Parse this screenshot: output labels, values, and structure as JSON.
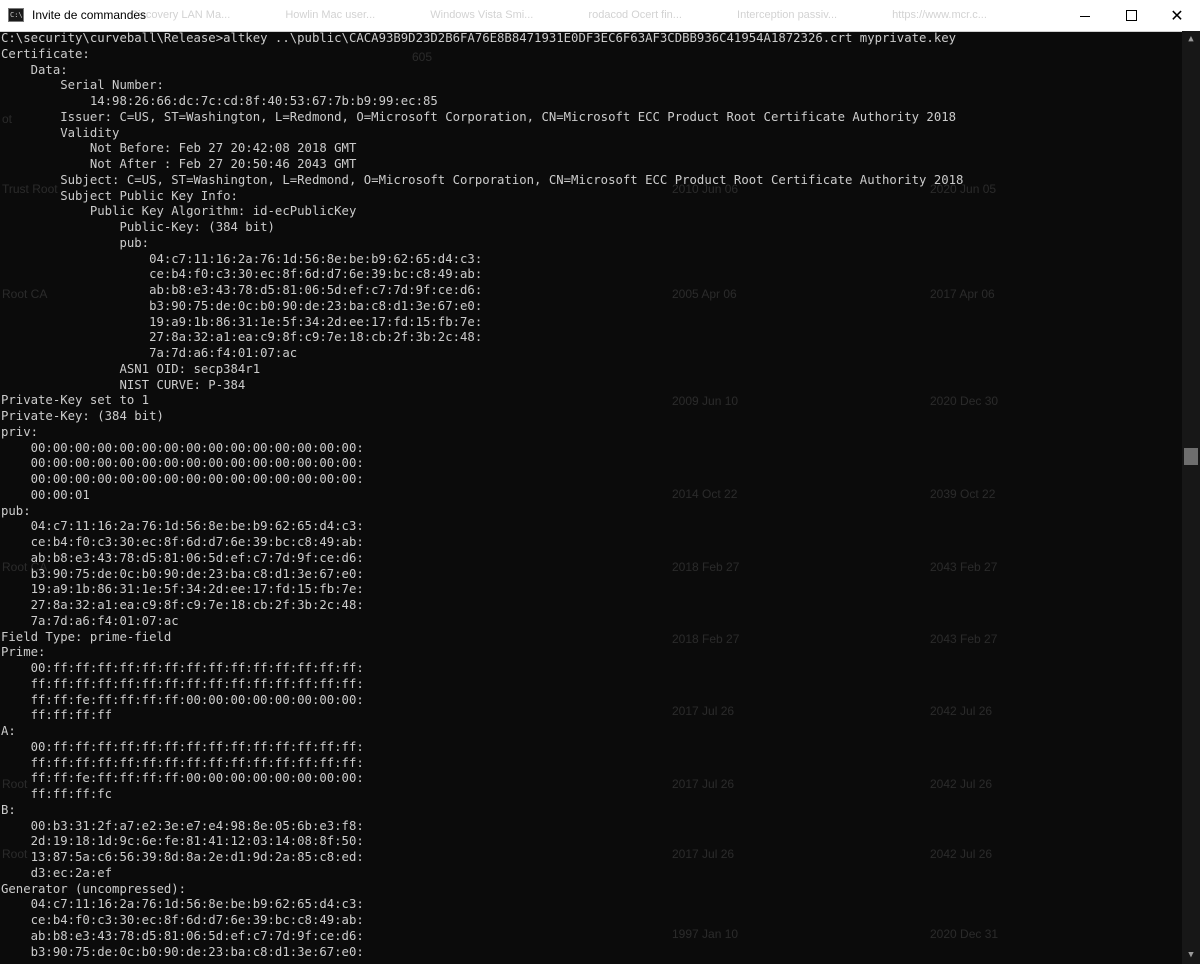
{
  "window": {
    "title": "Invite de commandes",
    "icon": "cmd-icon",
    "controls": {
      "minimize": "minimize-icon",
      "maximize": "maximize-icon",
      "close": "close-icon"
    }
  },
  "background_tabs": [
    "Ciscovery LAN Ma...",
    "Howlin Mac user...",
    "Windows Vista Smi...",
    "rodacod Ocert fin...",
    "Interception passiv...",
    "https://www.mcr.c..."
  ],
  "background_table_rows": [
    [
      "",
      "",
      "605",
      "",
      ""
    ],
    [
      "ot",
      "",
      "",
      "",
      ""
    ],
    [
      "Trust Root",
      "",
      "",
      "2010 Jun 06",
      "2020 Jun 05"
    ],
    [
      "Root CA",
      "",
      "",
      "2005 Apr 06",
      "2017 Apr 06"
    ],
    [
      "",
      "",
      "",
      "2009 Jun 10",
      "2020 Dec 30"
    ],
    [
      "",
      "",
      "",
      "2014 Oct 22",
      "2039 Oct 22"
    ],
    [
      "Root CA",
      "",
      "",
      "2018 Feb 27",
      "2043 Feb 27"
    ],
    [
      "",
      "",
      "",
      "2018 Feb 27",
      "2043 Feb 27"
    ],
    [
      "",
      "",
      "",
      "2017 Jul 26",
      "2042 Jul 26"
    ],
    [
      "Root",
      "",
      "",
      "2017 Jul 26",
      "2042 Jul 26"
    ],
    [
      "Root",
      "",
      "",
      "2017 Jul 26",
      "2042 Jul 26"
    ],
    [
      "",
      "",
      "",
      "1997 Jan 10",
      "2020 Dec 31"
    ]
  ],
  "console": {
    "lines": [
      "C:\\security\\curveball\\Release>altkey ..\\public\\CACA93B9D23D2B6FA76E8B8471931E0DF3EC6F63AF3CDBB936C41954A1872326.crt myprivate.key",
      "Certificate:",
      "    Data:",
      "        Serial Number:",
      "            14:98:26:66:dc:7c:cd:8f:40:53:67:7b:b9:99:ec:85",
      "        Issuer: C=US, ST=Washington, L=Redmond, O=Microsoft Corporation, CN=Microsoft ECC Product Root Certificate Authority 2018",
      "        Validity",
      "            Not Before: Feb 27 20:42:08 2018 GMT",
      "            Not After : Feb 27 20:50:46 2043 GMT",
      "        Subject: C=US, ST=Washington, L=Redmond, O=Microsoft Corporation, CN=Microsoft ECC Product Root Certificate Authority 2018",
      "        Subject Public Key Info:",
      "            Public Key Algorithm: id-ecPublicKey",
      "                Public-Key: (384 bit)",
      "                pub:",
      "                    04:c7:11:16:2a:76:1d:56:8e:be:b9:62:65:d4:c3:",
      "                    ce:b4:f0:c3:30:ec:8f:6d:d7:6e:39:bc:c8:49:ab:",
      "                    ab:b8:e3:43:78:d5:81:06:5d:ef:c7:7d:9f:ce:d6:",
      "                    b3:90:75:de:0c:b0:90:de:23:ba:c8:d1:3e:67:e0:",
      "                    19:a9:1b:86:31:1e:5f:34:2d:ee:17:fd:15:fb:7e:",
      "                    27:8a:32:a1:ea:c9:8f:c9:7e:18:cb:2f:3b:2c:48:",
      "                    7a:7d:a6:f4:01:07:ac",
      "                ASN1 OID: secp384r1",
      "                NIST CURVE: P-384",
      "Private-Key set to 1",
      "Private-Key: (384 bit)",
      "priv:",
      "    00:00:00:00:00:00:00:00:00:00:00:00:00:00:00:",
      "    00:00:00:00:00:00:00:00:00:00:00:00:00:00:00:",
      "    00:00:00:00:00:00:00:00:00:00:00:00:00:00:00:",
      "    00:00:01",
      "pub:",
      "    04:c7:11:16:2a:76:1d:56:8e:be:b9:62:65:d4:c3:",
      "    ce:b4:f0:c3:30:ec:8f:6d:d7:6e:39:bc:c8:49:ab:",
      "    ab:b8:e3:43:78:d5:81:06:5d:ef:c7:7d:9f:ce:d6:",
      "    b3:90:75:de:0c:b0:90:de:23:ba:c8:d1:3e:67:e0:",
      "    19:a9:1b:86:31:1e:5f:34:2d:ee:17:fd:15:fb:7e:",
      "    27:8a:32:a1:ea:c9:8f:c9:7e:18:cb:2f:3b:2c:48:",
      "    7a:7d:a6:f4:01:07:ac",
      "Field Type: prime-field",
      "Prime:",
      "    00:ff:ff:ff:ff:ff:ff:ff:ff:ff:ff:ff:ff:ff:ff:",
      "    ff:ff:ff:ff:ff:ff:ff:ff:ff:ff:ff:ff:ff:ff:ff:",
      "    ff:ff:fe:ff:ff:ff:ff:00:00:00:00:00:00:00:00:",
      "    ff:ff:ff:ff",
      "A:",
      "    00:ff:ff:ff:ff:ff:ff:ff:ff:ff:ff:ff:ff:ff:ff:",
      "    ff:ff:ff:ff:ff:ff:ff:ff:ff:ff:ff:ff:ff:ff:ff:",
      "    ff:ff:fe:ff:ff:ff:ff:00:00:00:00:00:00:00:00:",
      "    ff:ff:ff:fc",
      "B:",
      "    00:b3:31:2f:a7:e2:3e:e7:e4:98:8e:05:6b:e3:f8:",
      "    2d:19:18:1d:9c:6e:fe:81:41:12:03:14:08:8f:50:",
      "    13:87:5a:c6:56:39:8d:8a:2e:d1:9d:2a:85:c8:ed:",
      "    d3:ec:2a:ef",
      "Generator (uncompressed):",
      "    04:c7:11:16:2a:76:1d:56:8e:be:b9:62:65:d4:c3:",
      "    ce:b4:f0:c3:30:ec:8f:6d:d7:6e:39:bc:c8:49:ab:",
      "    ab:b8:e3:43:78:d5:81:06:5d:ef:c7:7d:9f:ce:d6:",
      "    b3:90:75:de:0c:b0:90:de:23:ba:c8:d1:3e:67:e0:"
    ]
  },
  "colors": {
    "console_bg": "#0b0b0b",
    "console_text": "#cccccc",
    "titlebar_bg": "#ffffff",
    "scrollbar_track": "#171717",
    "scrollbar_thumb": "#6e6e6e"
  }
}
